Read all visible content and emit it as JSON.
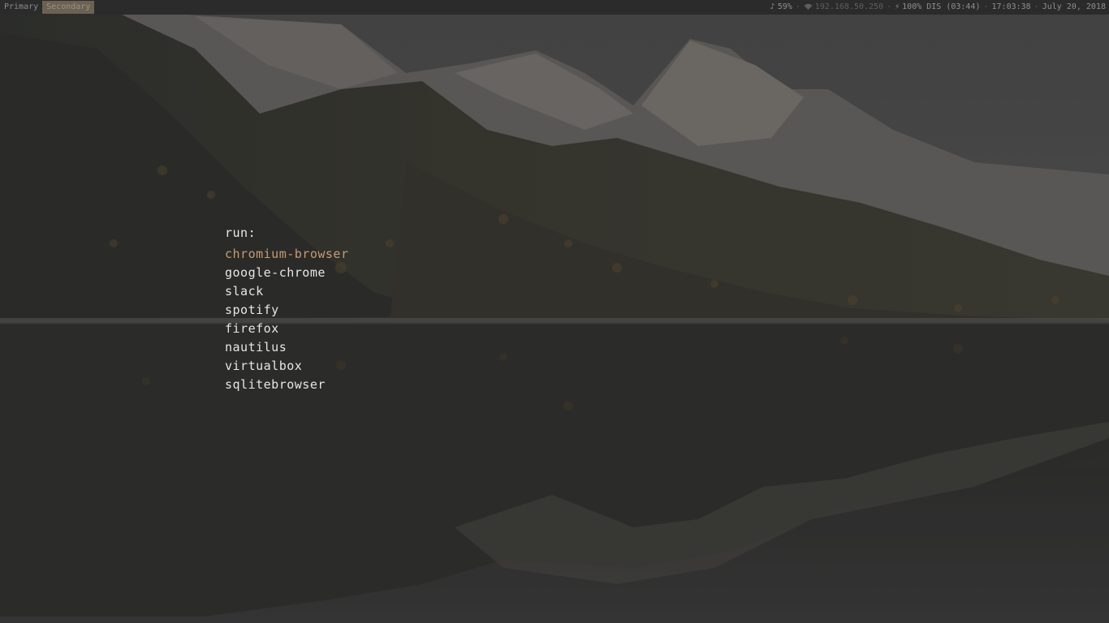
{
  "topbar": {
    "workspaces": [
      {
        "label": "Primary",
        "active": false
      },
      {
        "label": "Secondary",
        "active": true
      }
    ],
    "volume": {
      "icon": "music-note-icon",
      "label": "59%"
    },
    "network": {
      "icon": "wifi-icon",
      "label": "192.168.50.250"
    },
    "battery": {
      "icon": "lightning-icon",
      "label": "100% DIS (03:44)"
    },
    "time": "17:03:38",
    "date": "July 20, 2018"
  },
  "launcher": {
    "prompt": "run:",
    "items": [
      {
        "label": "chromium-browser",
        "selected": true
      },
      {
        "label": "google-chrome",
        "selected": false
      },
      {
        "label": "slack",
        "selected": false
      },
      {
        "label": "spotify",
        "selected": false
      },
      {
        "label": "firefox",
        "selected": false
      },
      {
        "label": "nautilus",
        "selected": false
      },
      {
        "label": "virtualbox",
        "selected": false
      },
      {
        "label": "sqlitebrowser",
        "selected": false
      }
    ]
  },
  "colors": {
    "selected_item": "#c89a74",
    "item_text": "#e6e6e6",
    "active_workspace": "#6b6253"
  }
}
